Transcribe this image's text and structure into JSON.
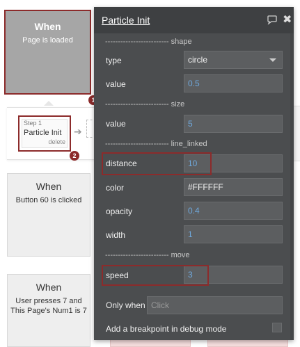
{
  "canvas": {
    "event_loaded": {
      "title": "When",
      "subtitle": "Page is loaded"
    },
    "step": {
      "number": "Step 1",
      "name": "Particle Init",
      "delete_label": "delete"
    },
    "event_button": {
      "title": "When",
      "subtitle": "Button 60 is clicked"
    },
    "event_user": {
      "title": "When",
      "subtitle_line1": "User presses 7 and",
      "subtitle_line2": "This Page's Num1 is 7"
    },
    "badges": [
      "1",
      "2"
    ]
  },
  "panel": {
    "title": "Particle Init",
    "comment_icon": "speech-bubble-icon",
    "close_icon": "close-icon",
    "sections": {
      "shape": "------------------------- shape",
      "size": "------------------------- size",
      "line_linked": "------------------------- line_linked",
      "move": "------------------------- move"
    },
    "fields": {
      "type": {
        "label": "type",
        "value": "circle"
      },
      "shape_value": {
        "label": "value",
        "value": "0.5"
      },
      "size_value": {
        "label": "value",
        "value": "5"
      },
      "distance": {
        "label": "distance",
        "value": "10"
      },
      "color": {
        "label": "color",
        "value": "#FFFFFF"
      },
      "opacity": {
        "label": "opacity",
        "value": "0.4"
      },
      "width": {
        "label": "width",
        "value": "1"
      },
      "speed": {
        "label": "speed",
        "value": "3"
      }
    },
    "only_when": {
      "label": "Only when",
      "placeholder": "Click"
    },
    "breakpoint_label": "Add a breakpoint in debug mode"
  },
  "colors": {
    "highlight": "#8c2b2b",
    "panel_bg": "#4b4d4f",
    "number_value": "#6fa8dc"
  }
}
